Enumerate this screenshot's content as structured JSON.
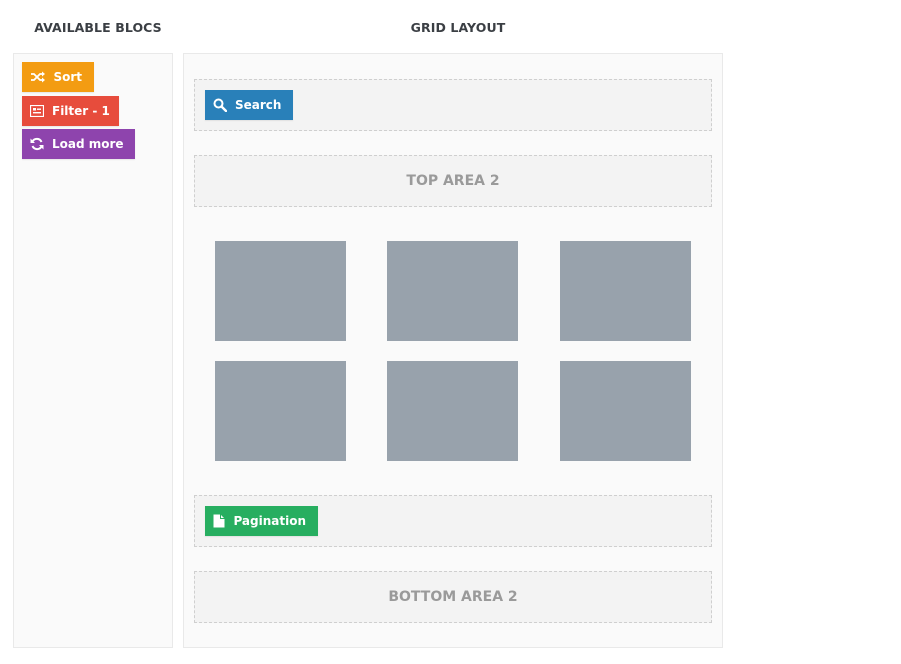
{
  "headings": {
    "available": "AVAILABLE BLOCS",
    "grid": "GRID LAYOUT"
  },
  "available_blocs": [
    {
      "label": "Sort",
      "icon": "shuffle-icon",
      "color": "#f39c12"
    },
    {
      "label": "Filter - 1",
      "icon": "filter-icon",
      "color": "#e74c3c"
    },
    {
      "label": "Load more",
      "icon": "refresh-icon",
      "color": "#8e44ad"
    }
  ],
  "grid_layout": {
    "top_area_1": {
      "bloc": {
        "label": "Search",
        "icon": "search-icon",
        "color": "#2980b9"
      }
    },
    "top_area_2": {
      "label": "TOP AREA 2"
    },
    "grid_items_count": 6,
    "grid_item_color": "#98a2ac",
    "bottom_area_1": {
      "bloc": {
        "label": "Pagination",
        "icon": "document-icon",
        "color": "#27ae60"
      }
    },
    "bottom_area_2": {
      "label": "BOTTOM AREA 2"
    }
  }
}
